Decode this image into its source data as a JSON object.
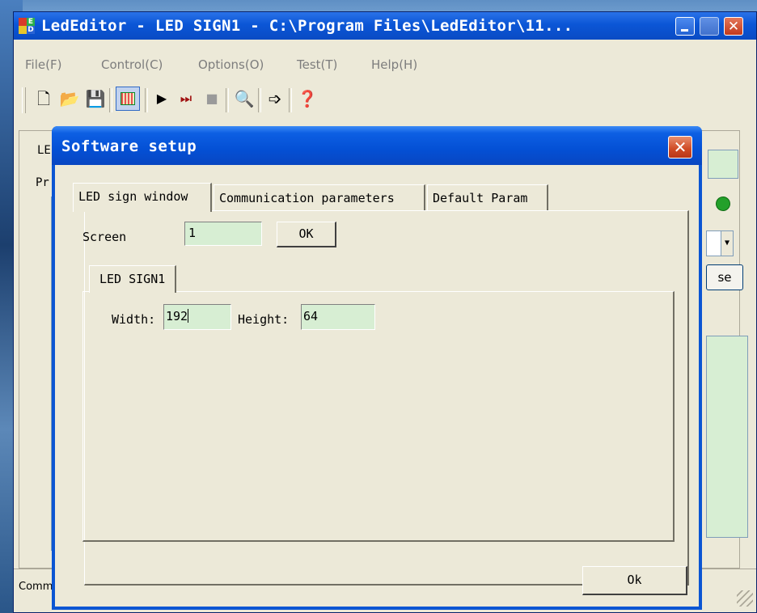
{
  "main_window": {
    "title": "LedEditor - LED SIGN1 - C:\\Program Files\\LedEditor\\11...",
    "icon_letters": [
      "E",
      "D"
    ]
  },
  "menu": [
    "File(F)",
    "Control(C)",
    "Options(O)",
    "Test(T)",
    "Help(H)"
  ],
  "toolbar": {
    "icons": [
      "new-file-icon",
      "open-folder-icon",
      "save-icon",
      "led-grid-icon",
      "play-icon",
      "step-play-icon",
      "stop-icon",
      "zoom-icon",
      "export-icon",
      "help-icon"
    ]
  },
  "background_panel": {
    "partial_label_1": "LE",
    "partial_label_2": "Pr",
    "partial_button": "se",
    "status_partial": "Comm"
  },
  "dialog": {
    "title": "Software setup",
    "tabs": [
      "LED sign window",
      "Communication parameters",
      "Default Param"
    ],
    "active_tab": "LED sign window",
    "screen_label": "Screen",
    "screen_value": "1",
    "screen_ok": "OK",
    "sign_tab": "LED SIGN1",
    "width_label": "Width:",
    "width_value": "192",
    "height_label": "Height:",
    "height_value": "64",
    "ok_button": "Ok"
  },
  "colors": {
    "titlebar_blue": "#0b55d3",
    "field_green": "#d7eed3",
    "window_face": "#ece9d8"
  }
}
